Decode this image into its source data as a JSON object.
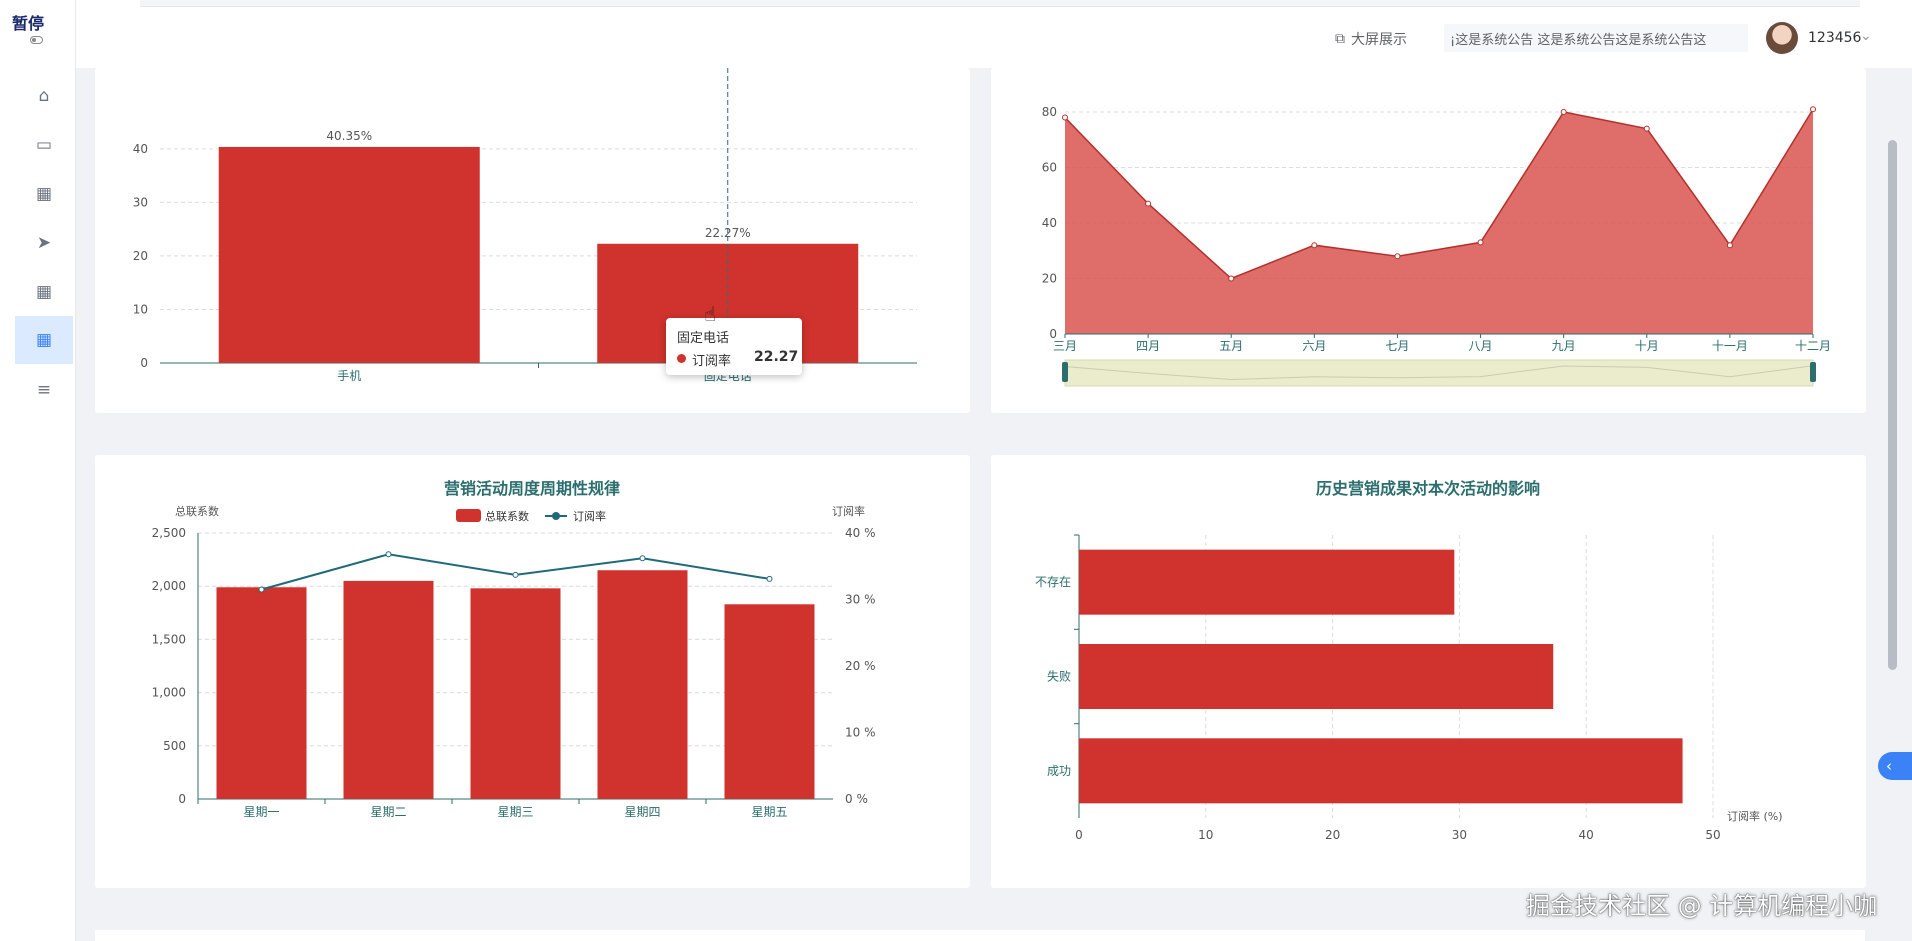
{
  "sidebar": {
    "logo_text": "暂停",
    "items": [
      {
        "icon": "home-icon",
        "glyph": "⌂"
      },
      {
        "icon": "card-icon",
        "glyph": "▭"
      },
      {
        "icon": "grid-icon",
        "glyph": "▦"
      },
      {
        "icon": "send-icon",
        "glyph": "➤"
      },
      {
        "icon": "apps-icon",
        "glyph": "▦"
      },
      {
        "icon": "dashboard-icon",
        "glyph": "▦",
        "active": true
      },
      {
        "icon": "menu-icon",
        "glyph": "≡"
      }
    ]
  },
  "header": {
    "big_screen_label": "大屏展示",
    "notice_text": "¡这是系统公告    这是系统公告这是系统公告这",
    "username": "123456",
    "caret": "⌄"
  },
  "charts": [
    {
      "type": "bar",
      "categories": [
        "手机",
        "固定电话"
      ],
      "values": [
        40.35,
        22.27
      ],
      "data_labels": [
        "40.35%",
        "22.27%"
      ],
      "y_ticks": [
        "0",
        "10",
        "20",
        "30",
        "40"
      ],
      "ylim": [
        0,
        48
      ],
      "bar_color": "#d0322d"
    },
    {
      "type": "area",
      "categories": [
        "三月",
        "四月",
        "五月",
        "六月",
        "七月",
        "八月",
        "九月",
        "十月",
        "十一月",
        "十二月"
      ],
      "values": [
        78,
        47,
        20,
        32,
        28,
        33,
        80,
        74,
        32,
        81
      ],
      "y_ticks": [
        "0",
        "20",
        "40",
        "60",
        "80"
      ],
      "ylim": [
        0,
        80
      ],
      "fill_color": "#d9534f"
    },
    {
      "type": "bar",
      "title": "营销活动周度周期性规律",
      "categories": [
        "星期一",
        "星期二",
        "星期三",
        "星期四",
        "星期五"
      ],
      "y_left_label": "总联系数",
      "y_right_label": "订阅率",
      "legend": [
        "总联系数",
        "订阅率"
      ],
      "left_ticks": [
        "0",
        "500",
        "1,000",
        "1,500",
        "2,000",
        "2,500"
      ],
      "right_ticks": [
        "0 %",
        "10 %",
        "20 %",
        "30 %",
        "40 %"
      ],
      "series": [
        {
          "name": "总联系数",
          "type": "bar",
          "values": [
            1990,
            2050,
            1980,
            2150,
            1830
          ]
        },
        {
          "name": "订阅率",
          "type": "line",
          "values": [
            31.5,
            36.8,
            33.7,
            36.2,
            33.1
          ]
        }
      ],
      "ylim_left": [
        0,
        2500
      ],
      "ylim_right": [
        0,
        40
      ]
    },
    {
      "type": "bar",
      "orientation": "horizontal",
      "title": "历史营销成果对本次活动的影响",
      "categories": [
        "不存在",
        "失败",
        "成功"
      ],
      "values": [
        29.6,
        37.4,
        47.6
      ],
      "x_ticks": [
        "0",
        "10",
        "20",
        "30",
        "40",
        "50"
      ],
      "xlabel": "订阅率 (%)",
      "xlim": [
        0,
        50
      ]
    }
  ],
  "tooltip": {
    "title": "固定电话",
    "series": "订阅率",
    "value": "22.27"
  },
  "watermark": "掘金技术社区 @ 计算机编程小咖"
}
